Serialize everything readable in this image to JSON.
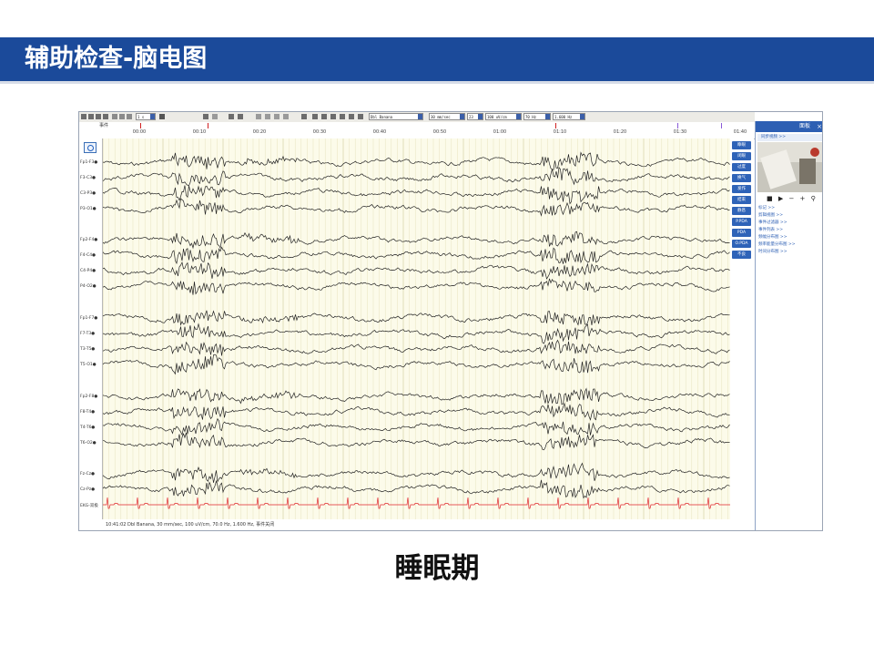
{
  "slide": {
    "title": "辅助检查-脑电图",
    "caption": "睡眠期"
  },
  "toolbar": {
    "page_value": "1 s",
    "montage": "Dbl Banana",
    "speed": "30 mm/sec",
    "gain_step": "23",
    "sensitivity": "100 uV/cm",
    "lowpass": "70 Hz",
    "highpass": "1.600 Hz"
  },
  "timeline": {
    "events_label": "事件",
    "ticks": [
      "00:00",
      "00:10",
      "00:20",
      "00:30",
      "00:40",
      "00:50",
      "01:00",
      "01:10",
      "01:20",
      "01:30",
      "01:40"
    ]
  },
  "channels": {
    "group1": [
      "Fp1-F3●",
      "F3-C3●",
      "C3-P3●",
      "P3-O1●"
    ],
    "group2": [
      "Fp2-F4●",
      "F4-C4●",
      "C4-P4●",
      "P4-O2●"
    ],
    "group3": [
      "Fp1-F7●",
      "F7-T3●",
      "T3-T5●",
      "T5-O1●"
    ],
    "group4": [
      "Fp2-F8●",
      "F8-T4●",
      "T4-T6●",
      "T6-O2●"
    ],
    "group5": [
      "Fz-Cz●",
      "Cz-Pz●",
      "EKG-双极"
    ]
  },
  "annotations": [
    "睁眼",
    "闭眼",
    "过度",
    "换气",
    "发作",
    "结束",
    "静息",
    "P.PDA",
    "PDA",
    "O.PDA",
    "不良"
  ],
  "status_text": "10:41:02 Dbl Banana, 30 mm/sec, 100 uV/cm, 70.0 Hz, 1.600 Hz, 事件关闭",
  "panel": {
    "title": "面板",
    "close": "×",
    "video_section": "同步视频 >>",
    "video_controls": "■ ▶ − + ⚲",
    "links": [
      "标记 >>",
      "剪辑视图 >>",
      "事件过滤器 >>",
      "事件列表 >>",
      "频幅分布图 >>",
      "频率能量分布图 >>",
      "时间分布图 >>"
    ]
  },
  "colors": {
    "title_bar": "#1b4a9a",
    "eeg_trace": "#222222",
    "ekg_trace": "#e0262c",
    "annotation_button": "#2f63b8",
    "plot_background": "#fcfbea"
  }
}
